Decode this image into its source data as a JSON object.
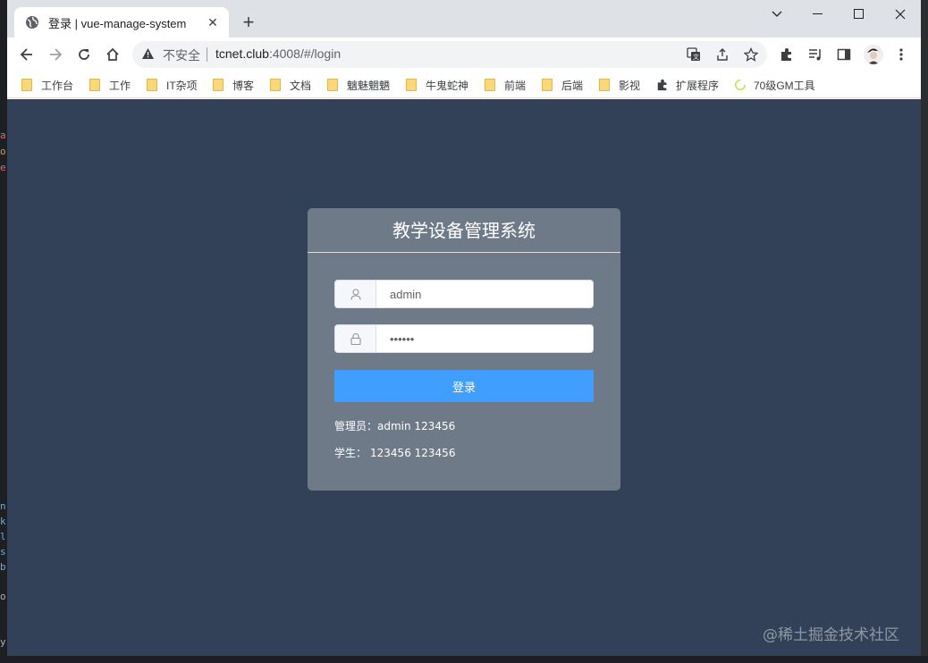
{
  "browser": {
    "tab_title": "登录 | vue-manage-system",
    "new_tab_label": "+",
    "security_label": "不安全",
    "url_host": "tcnet.club",
    "url_rest": ":4008/#/login"
  },
  "bookmarks": [
    {
      "label": "工作台",
      "icon": "folder-icon"
    },
    {
      "label": "工作",
      "icon": "folder-icon"
    },
    {
      "label": "IT杂项",
      "icon": "folder-icon"
    },
    {
      "label": "博客",
      "icon": "folder-icon"
    },
    {
      "label": "文档",
      "icon": "folder-icon"
    },
    {
      "label": "魑魅魍魉",
      "icon": "folder-icon"
    },
    {
      "label": "牛鬼蛇神",
      "icon": "folder-icon"
    },
    {
      "label": "前端",
      "icon": "folder-icon"
    },
    {
      "label": "后端",
      "icon": "folder-icon"
    },
    {
      "label": "影视",
      "icon": "folder-icon"
    },
    {
      "label": "扩展程序",
      "icon": "puzzle-icon"
    },
    {
      "label": "70级GM工具",
      "icon": "loading-icon"
    }
  ],
  "login": {
    "title": "教学设备管理系统",
    "username_value": "admin",
    "password_value": "••••••",
    "submit_label": "登录",
    "hint_admin_label": "管理员：",
    "hint_admin_creds": "admin 123456",
    "hint_student_label": "学生：",
    "hint_student_creds": "123456 123456"
  },
  "watermark": "@稀土掘金技术社区",
  "colors": {
    "page_bg": "#324157",
    "primary": "#409eff",
    "tabbar_bg": "#dee1e6"
  }
}
